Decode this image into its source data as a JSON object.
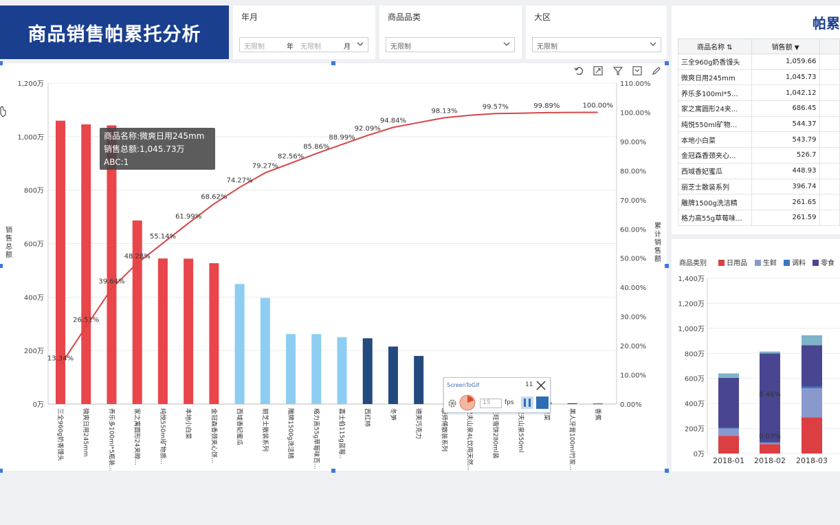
{
  "title": "商品销售帕累托分析",
  "filters": {
    "year_month": {
      "label": "年月",
      "year_placeholder": "无限制",
      "year_unit": "年",
      "month_placeholder": "无限制",
      "month_unit": "月"
    },
    "category": {
      "label": "商品品类",
      "value": "无限制"
    },
    "region": {
      "label": "大区",
      "value": "无限制"
    }
  },
  "main_chart": {
    "toolbar_icons": [
      "undo-icon",
      "expand-icon",
      "filter-icon",
      "collapse-icon",
      "edit-icon"
    ],
    "left_axis_label": "销售总额",
    "right_axis_label": "累计销售额",
    "tooltip": {
      "line1": "商品名称:微爽日用245mm",
      "line2": "销售总额:1,045.73万",
      "line3": "ABC:1"
    }
  },
  "chart_data": [
    {
      "type": "bar",
      "title": "",
      "ylabel": "销售总额",
      "y2label": "累计销售额",
      "ylim": [
        0,
        1200
      ],
      "y2lim": [
        0,
        110
      ],
      "y_ticks": [
        "0万",
        "200万",
        "400万",
        "600万",
        "800万",
        "1,000万",
        "1,200万"
      ],
      "y2_ticks": [
        "0.00%",
        "10.00%",
        "20.00%",
        "30.00%",
        "40.00%",
        "50.00%",
        "60.00%",
        "70.00%",
        "80.00%",
        "90.00%",
        "100.00%",
        "110.00%"
      ],
      "categories": [
        "三全960g奶香馒头",
        "微爽日用245mm",
        "养乐多100ml*5瓶装...",
        "家之寓圆形24夹晾...",
        "纯悦550ml矿物质...",
        "本地小白菜",
        "金冠森香颈夹心饼...",
        "西域香妃蜜瓜",
        "丽芝士散装系列",
        "雕牌1500g洗洁精",
        "格力高55g草莓味百...",
        "嘉士伯115g蓝莓..",
        "西红柿",
        "冬笋",
        "德芙巧克力",
        "康师傅散装系列",
        "农夫山泉4L饮用天然...",
        "旺旺雪饼280ml装",
        "农夫山泉550ml",
        "青菜",
        "黑人牙膏100ml竹炭...",
        "香蕉"
      ],
      "values": [
        1059.66,
        1045.73,
        1042.12,
        686.45,
        544.37,
        543.79,
        526.7,
        448.93,
        396.74,
        261.65,
        261.59,
        250,
        246,
        215,
        180,
        0,
        0,
        0,
        0,
        6,
        3,
        2
      ],
      "abc": [
        "A",
        "A",
        "A",
        "A",
        "A",
        "A",
        "A",
        "B",
        "B",
        "B",
        "B",
        "B",
        "C",
        "C",
        "C",
        "C",
        "C",
        "C",
        "C",
        "C",
        "C",
        "C"
      ],
      "colors": {
        "A": "#e8464a",
        "B": "#8ecdf2",
        "C": "#234a7e",
        "line": "#d64545"
      },
      "series": [
        {
          "name": "销售总额",
          "values": [
            1059.66,
            1045.73,
            1042.12,
            686.45,
            544.37,
            543.79,
            526.7,
            448.93,
            396.74,
            261.65,
            261.59,
            250,
            246,
            215,
            180,
            0,
            0,
            0,
            0,
            6,
            3,
            2
          ]
        },
        {
          "name": "累计销售额",
          "values": [
            13.34,
            26.51,
            39.64,
            48.28,
            55.14,
            61.99,
            68.62,
            74.27,
            79.27,
            82.56,
            85.86,
            88.99,
            92.09,
            94.84,
            96.5,
            98.13,
            99.0,
            99.57,
            99.7,
            99.89,
            99.95,
            100.0
          ]
        }
      ],
      "line_labels": [
        "13.34%",
        "26.51%",
        "39.64%",
        "48.28%",
        "55.14%",
        "61.99%",
        "68.62%",
        "74.27%",
        "79.27%",
        "82.56%",
        "85.86%",
        "88.99%",
        "92.09%",
        "94.84%",
        "",
        "98.13%",
        "",
        "99.57%",
        "",
        "99.89%",
        "",
        "100.00%"
      ]
    },
    {
      "type": "bar",
      "title": "",
      "stacked": true,
      "ylim": [
        0,
        1400
      ],
      "y_ticks": [
        "0万",
        "200万",
        "400万",
        "600万",
        "800万",
        "1,000万",
        "1,200万",
        "1,400万"
      ],
      "legend_title": "商品类别",
      "categories": [
        "2018-01",
        "2018-02",
        "2018-03"
      ],
      "series": [
        {
          "name": "日用品",
          "color": "#dc3f42",
          "values": [
            140,
            75,
            290
          ]
        },
        {
          "name": "生鲜",
          "color": "#8a99cc",
          "values": [
            60,
            10,
            230
          ]
        },
        {
          "name": "调料",
          "color": "#3b78c4",
          "values": [
            5,
            5,
            15
          ]
        },
        {
          "name": "零食",
          "color": "#4a4591",
          "values": [
            400,
            710,
            330
          ]
        },
        {
          "name": "",
          "color": "#7fb3c9",
          "values": [
            35,
            15,
            80
          ]
        }
      ],
      "data_labels": [
        "8.46%",
        "0.03%"
      ]
    }
  ],
  "table": {
    "columns": [
      "商品名称",
      "销售额"
    ],
    "rows": [
      [
        "三全960g奶香馒头",
        "1,059.66"
      ],
      [
        "微爽日用245mm",
        "1,045.73"
      ],
      [
        "养乐多100ml*5...",
        "1,042.12"
      ],
      [
        "家之寓圆形24夹...",
        "686.45"
      ],
      [
        "纯悦550ml矿物...",
        "544.37"
      ],
      [
        "本地小白菜",
        "543.79"
      ],
      [
        "金冠森香颈夹心...",
        "526.7"
      ],
      [
        "西域香妃蜜瓜",
        "448.93"
      ],
      [
        "丽芝士散装系列",
        "396.74"
      ],
      [
        "雕牌1500g洗洁精",
        "261.65"
      ],
      [
        "格力高55g草莓味...",
        "261.59"
      ]
    ]
  },
  "right_title": "帕累",
  "screentogif": {
    "title": "ScreenToGif",
    "count": "11",
    "fps_value": "15",
    "fps_label": "fps"
  }
}
